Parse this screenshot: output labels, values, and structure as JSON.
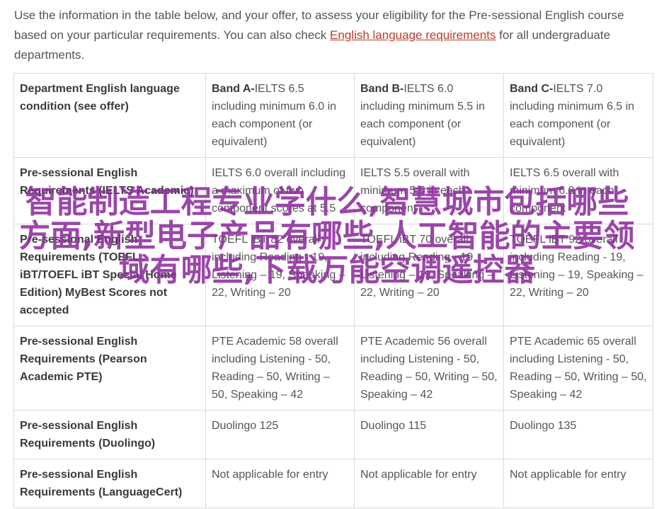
{
  "intro": {
    "text_before": "Use the information in the table below, and your offer, to assess your eligibility for the Pre-sessional English course based on your particular requirements. You can also check ",
    "link_text": "English language requirements",
    "text_after": " for all undergraduate departments."
  },
  "table": {
    "header": {
      "condition_label": "Department English language condition (see offer)",
      "bands": [
        {
          "name": "Band A-",
          "detail": "IELTS 6.5 including minimum 6.0 in each component (or equivalent)"
        },
        {
          "name": "Band B-",
          "detail": "IELTS 6.0 including minimum 5.5 in each component (or equivalent)"
        },
        {
          "name": "Band C-",
          "detail": "IELTS 7.0 including minimum 6.5 in each component (or equivalent)"
        }
      ]
    },
    "rows": [
      {
        "label": "Pre-sessional English Requirements (IELTS Academic)",
        "cells": [
          "IELTS 6.0 overall including a maximum of two component scores at 5.5",
          "IELTS 5.5 overall with minimum 5.5 in each component",
          "IELTS 6.5 overall with minimum 6.0 in each component"
        ]
      },
      {
        "label": "Pre-sessional English Requirements (TOEFL iBT/TOEFL iBT Special Home Edition) MyBest Scores not accepted",
        "cells": [
          "TOEFL iBT 82 overall including Reading - 19, Listening – 19, Speaking – 22, Writing – 20",
          "TOEFL iBT 70 overall including Reading - 19, Listening – 19, Speaking – 22, Writing – 20",
          "TOEFL iBT 92 overall including Reading - 19, Listening – 19, Speaking – 22, Writing – 20"
        ]
      },
      {
        "label": "Pre-sessional English Requirements (Pearson Academic PTE)",
        "cells": [
          "PTE Academic 58 overall including Listening - 50, Reading – 50, Writing – 50, Speaking – 42",
          "PTE Academic 56 overall including Listening - 50, Reading – 50, Writing – 50, Speaking – 42",
          "PTE Academic 65 overall including Listening - 50, Reading – 50, Writing – 50, Speaking – 42"
        ]
      },
      {
        "label": "Pre-sessional English Requirements (Duolingo)",
        "cells": [
          "Duolingo 125",
          "Duolingo 115",
          "Duolingo 135"
        ]
      },
      {
        "label": "Pre-sessional English Requirements (LanguageCert)",
        "cells": [
          "Not applicable for entry",
          "Not applicable for entry",
          "Not applicable for entry"
        ]
      }
    ]
  },
  "overlay_text": "智能制造工程专业学什么,智慧城市包括哪些方面,新型电子产品有哪些,人工智能的主要领域有哪些,下载万能空调遥控器",
  "colors": {
    "link": "#c0392b",
    "overlay": "#8e2d9e",
    "border": "#d9d9d9"
  }
}
